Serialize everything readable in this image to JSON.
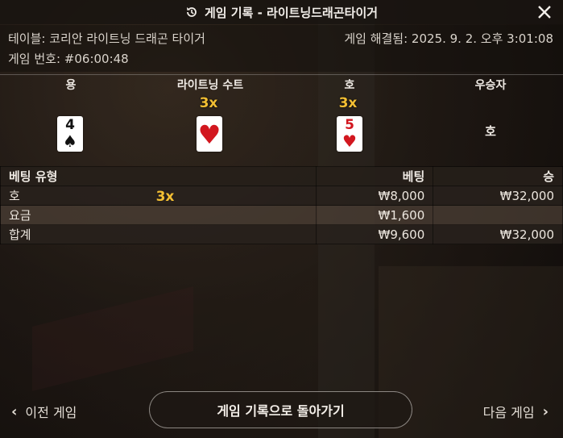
{
  "window": {
    "title": "게임 기록 - 라이트닝드래곤타이거",
    "history_icon": "history-icon",
    "close_icon": "close-icon"
  },
  "info": {
    "table_label": "테이블: 코리안 라이트닝 드래곤 타이거",
    "game_number": "게임 번호: #06:00:48",
    "resolved": "게임 해결됨: 2025. 9. 2. 오후 3:01:08"
  },
  "result": {
    "headers": [
      "용",
      "라이트닝 수트",
      "호",
      "우승자"
    ],
    "dragon_card": {
      "rank": "4",
      "suit": "♠",
      "color": "black"
    },
    "lightning_suit": {
      "multiplier": "3x",
      "suit": "♥",
      "color": "red"
    },
    "tiger_card": {
      "multiplier": "3x",
      "rank": "5",
      "suit": "♥",
      "color": "red"
    },
    "winner": "호"
  },
  "bets": {
    "headers": {
      "type": "베팅 유형",
      "bet": "베팅",
      "win": "승"
    },
    "rows": [
      {
        "type": "호",
        "multiplier": "3x",
        "bet": "₩8,000",
        "win": "₩32,000"
      },
      {
        "type": "요금",
        "bet": "₩1,600",
        "win": ""
      },
      {
        "type": "합계",
        "bet": "₩9,600",
        "win": "₩32,000"
      }
    ]
  },
  "footer": {
    "prev_label": "이전 게임",
    "back_label": "게임 기록으로 돌아가기",
    "next_label": "다음 게임"
  },
  "colors": {
    "multiplier": "#f3bf33",
    "red_suit": "#d2171f"
  }
}
